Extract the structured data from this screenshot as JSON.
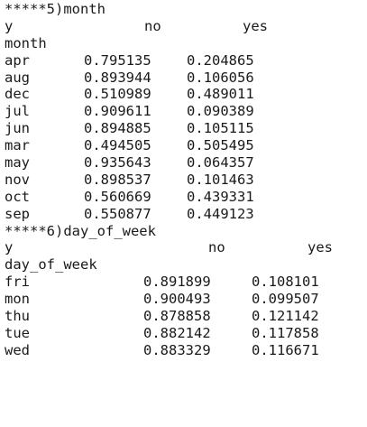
{
  "month_section": {
    "title": "*****5)month",
    "header_y": "y",
    "col_no": "no",
    "col_yes": "yes",
    "index_name": "month",
    "rows": [
      {
        "label": "apr",
        "no": "0.795135",
        "yes": "0.204865"
      },
      {
        "label": "aug",
        "no": "0.893944",
        "yes": "0.106056"
      },
      {
        "label": "dec",
        "no": "0.510989",
        "yes": "0.489011"
      },
      {
        "label": "jul",
        "no": "0.909611",
        "yes": "0.090389"
      },
      {
        "label": "jun",
        "no": "0.894885",
        "yes": "0.105115"
      },
      {
        "label": "mar",
        "no": "0.494505",
        "yes": "0.505495"
      },
      {
        "label": "may",
        "no": "0.935643",
        "yes": "0.064357"
      },
      {
        "label": "nov",
        "no": "0.898537",
        "yes": "0.101463"
      },
      {
        "label": "oct",
        "no": "0.560669",
        "yes": "0.439331"
      },
      {
        "label": "sep",
        "no": "0.550877",
        "yes": "0.449123"
      }
    ]
  },
  "day_section": {
    "title": "*****6)day_of_week",
    "header_y": "y",
    "col_no": "no",
    "col_yes": "yes",
    "index_name": "day_of_week",
    "rows": [
      {
        "label": "fri",
        "no": "0.891899",
        "yes": "0.108101"
      },
      {
        "label": "mon",
        "no": "0.900493",
        "yes": "0.099507"
      },
      {
        "label": "thu",
        "no": "0.878858",
        "yes": "0.121142"
      },
      {
        "label": "tue",
        "no": "0.882142",
        "yes": "0.117858"
      },
      {
        "label": "wed",
        "no": "0.883329",
        "yes": "0.116671"
      }
    ]
  }
}
